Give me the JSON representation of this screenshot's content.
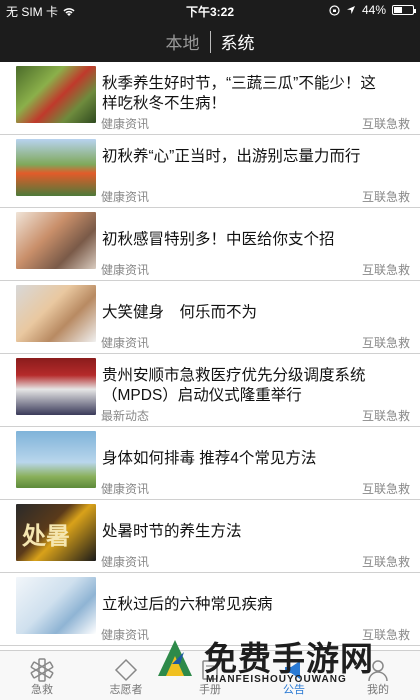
{
  "status_bar": {
    "carrier": "无 SIM 卡",
    "time": "下午3:22",
    "battery_text": "44%",
    "battery_level": 0.44
  },
  "header": {
    "tabs": [
      {
        "label": "本地",
        "active": false
      },
      {
        "label": "系统",
        "active": true
      }
    ]
  },
  "news": [
    {
      "title": "秋季养生好时节，“三蔬三瓜”不能少！这样吃秋冬不生病！",
      "category": "健康资讯",
      "source": "互联急救",
      "thumb": "vegetables"
    },
    {
      "title": "初秋养“心”正当时，出游别忘量力而行",
      "category": "健康资讯",
      "source": "互联急救",
      "thumb": "hiking-group"
    },
    {
      "title": "初秋感冒特别多！中医给你支个招",
      "category": "健康资讯",
      "source": "互联急救",
      "thumb": "sick-woman"
    },
    {
      "title": "大笑健身　何乐而不为",
      "category": "健康资讯",
      "source": "互联急救",
      "thumb": "laughing-couple"
    },
    {
      "title": "贵州安顺市急救医疗优先分级调度系统（MPDS）启动仪式隆重举行",
      "category": "最新动态",
      "source": "互联急救",
      "thumb": "ceremony"
    },
    {
      "title": "身体如何排毒 推荐4个常见方法",
      "category": "健康资讯",
      "source": "互联急救",
      "thumb": "sky-field"
    },
    {
      "title": "处暑时节的养生方法",
      "category": "健康资讯",
      "source": "互联急救",
      "thumb": "chushu-calligraphy",
      "thumb_text": "处暑"
    },
    {
      "title": "立秋过后的六种常见疾病",
      "category": "健康资讯",
      "source": "互联急救",
      "thumb": "doctor-stethoscope"
    }
  ],
  "tabbar": {
    "items": [
      {
        "label": "急救",
        "icon": "star-of-life-icon",
        "active": false
      },
      {
        "label": "志愿者",
        "icon": "diamond-icon",
        "active": false
      },
      {
        "label": "手册",
        "icon": "book-icon",
        "active": false
      },
      {
        "label": "公告",
        "icon": "megaphone-icon",
        "active": true
      },
      {
        "label": "我的",
        "icon": "person-icon",
        "active": false
      }
    ]
  },
  "watermark": {
    "text": "免费手游网",
    "sub": "MIANFEISHOUYOUWANG"
  },
  "colors": {
    "header_bg": "#1c1c1c",
    "accent": "#2a7ad4",
    "meta_text": "#888888"
  }
}
